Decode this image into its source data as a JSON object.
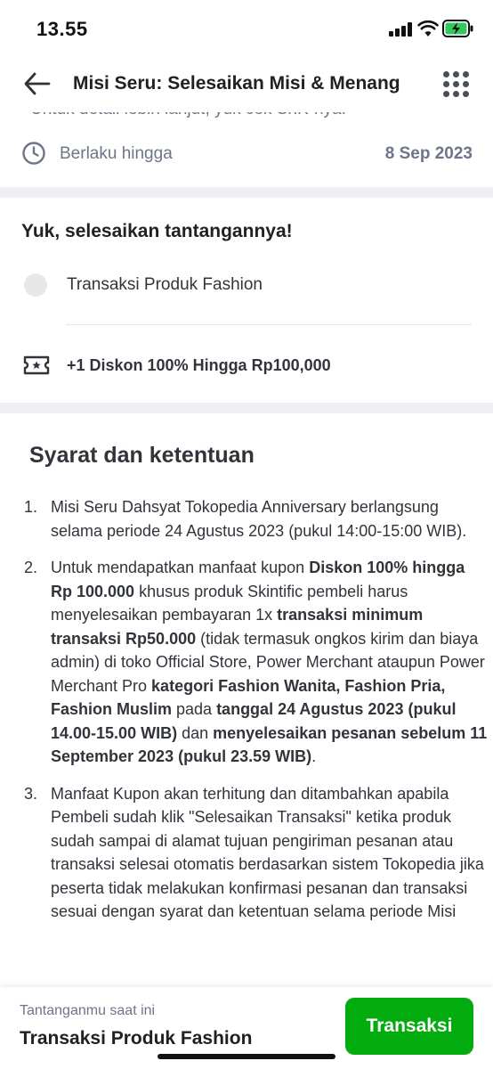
{
  "status_bar": {
    "time": "13.55"
  },
  "header": {
    "title": "Misi Seru: Selesaikan Misi & Menang",
    "back_icon": "arrow-left-icon",
    "menu_icon": "grid-dots-icon"
  },
  "cut_off_text": "Untuk detail lebih lanjut, yuk cek SnK-nya.",
  "validity": {
    "label": "Berlaku hingga",
    "date": "8 Sep 2023"
  },
  "challenge": {
    "title": "Yuk, selesaikan tantangannya!",
    "task": "Transaksi Produk Fashion",
    "reward": "+1 Diskon 100% Hingga Rp100,000"
  },
  "terms": {
    "title": "Syarat dan ketentuan",
    "items": [
      {
        "num": "1.",
        "parts": [
          {
            "text": "Misi Seru Dahsyat Tokopedia Anniversary berlangsung selama periode 24 Agustus 2023 (pukul 14:00-15:00 WIB).",
            "bold": false
          }
        ]
      },
      {
        "num": "2.",
        "parts": [
          {
            "text": "Untuk mendapatkan manfaat kupon ",
            "bold": false
          },
          {
            "text": "Diskon 100% hingga Rp 100.000",
            "bold": true
          },
          {
            "text": " khusus produk Skintific pembeli harus menyelesaikan pembayaran 1x ",
            "bold": false
          },
          {
            "text": "transaksi minimum transaksi Rp50.000",
            "bold": true
          },
          {
            "text": " (tidak termasuk ongkos kirim dan biaya admin) di toko Official Store, Power Merchant ataupun Power Merchant Pro ",
            "bold": false
          },
          {
            "text": "kategori Fashion Wanita, Fashion Pria, Fashion Muslim",
            "bold": true
          },
          {
            "text": " pada ",
            "bold": false
          },
          {
            "text": "tanggal 24 Agustus 2023 (pukul 14.00-15.00 WIB)",
            "bold": true
          },
          {
            "text": " dan ",
            "bold": false
          },
          {
            "text": "menyelesaikan pesanan sebelum 11 September 2023 (pukul 23.59 WIB)",
            "bold": true
          },
          {
            "text": ".",
            "bold": false
          }
        ]
      },
      {
        "num": "3.",
        "parts": [
          {
            "text": "Manfaat Kupon akan terhitung dan ditambahkan apabila Pembeli sudah klik \"Selesaikan Transaksi\" ketika produk sudah sampai di alamat tujuan pengiriman pesanan atau transaksi selesai otomatis berdasarkan sistem Tokopedia jika peserta tidak melakukan konfirmasi pesanan dan transaksi sesuai dengan syarat dan ketentuan selama periode Misi",
            "bold": false
          }
        ]
      }
    ]
  },
  "bottom_bar": {
    "label": "Tantanganmu saat ini",
    "value": "Transaksi Produk Fashion",
    "button": "Transaksi"
  },
  "colors": {
    "accent": "#03ac0e",
    "muted": "#6d7588",
    "text": "#31353b",
    "band": "#eff0f5"
  }
}
